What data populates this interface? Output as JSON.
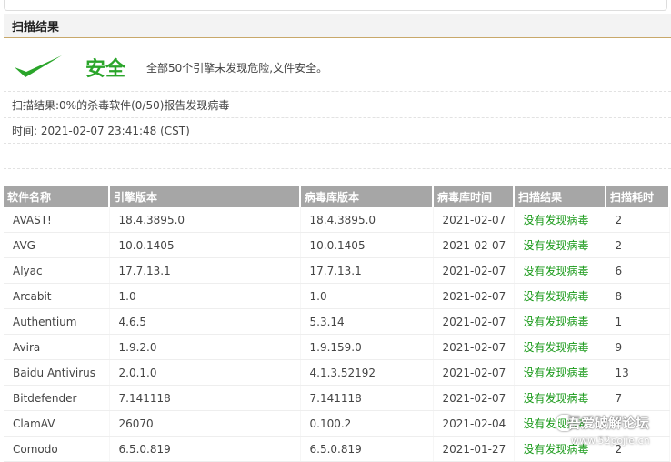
{
  "header": {
    "title": "扫描结果"
  },
  "summary": {
    "status": "安全",
    "description": "全部50个引擎未发现危险,文件安全。",
    "result_line": "扫描结果:0%的杀毒软件(0/50)报告发现病毒",
    "time_line": "时间: 2021-02-07 23:41:48 (CST)"
  },
  "table": {
    "columns": [
      "软件名称",
      "引擎版本",
      "病毒库版本",
      "病毒库时间",
      "扫描结果",
      "扫描耗时"
    ],
    "rows": [
      [
        "AVAST!",
        "18.4.3895.0",
        "18.4.3895.0",
        "2021-02-07",
        "没有发现病毒",
        "2"
      ],
      [
        "AVG",
        "10.0.1405",
        "10.0.1405",
        "2021-02-07",
        "没有发现病毒",
        "2"
      ],
      [
        "Alyac",
        "17.7.13.1",
        "17.7.13.1",
        "2021-02-07",
        "没有发现病毒",
        "6"
      ],
      [
        "Arcabit",
        "1.0",
        "1.0",
        "2021-02-07",
        "没有发现病毒",
        "8"
      ],
      [
        "Authentium",
        "4.6.5",
        "5.3.14",
        "2021-02-07",
        "没有发现病毒",
        "1"
      ],
      [
        "Avira",
        "1.9.2.0",
        "1.9.159.0",
        "2021-02-07",
        "没有发现病毒",
        "9"
      ],
      [
        "Baidu Antivirus",
        "2.0.1.0",
        "4.1.3.52192",
        "2021-02-07",
        "没有发现病毒",
        "13"
      ],
      [
        "Bitdefender",
        "7.141118",
        "7.141118",
        "2021-02-07",
        "没有发现病毒",
        "7"
      ],
      [
        "ClamAV",
        "26070",
        "0.100.2",
        "2021-02-04",
        "没有发现病毒",
        "1"
      ],
      [
        "Comodo",
        "6.5.0.819",
        "6.5.0.819",
        "2021-01-27",
        "没有发现病毒",
        "2"
      ]
    ]
  },
  "watermark": {
    "text": "吾爱破解论坛",
    "url": "www.52pojie.cn"
  },
  "colors": {
    "safe": "#2aa52a",
    "result": "#1a9a1a",
    "table_header": "#a6a6a6",
    "header_border": "#c8a86a"
  }
}
